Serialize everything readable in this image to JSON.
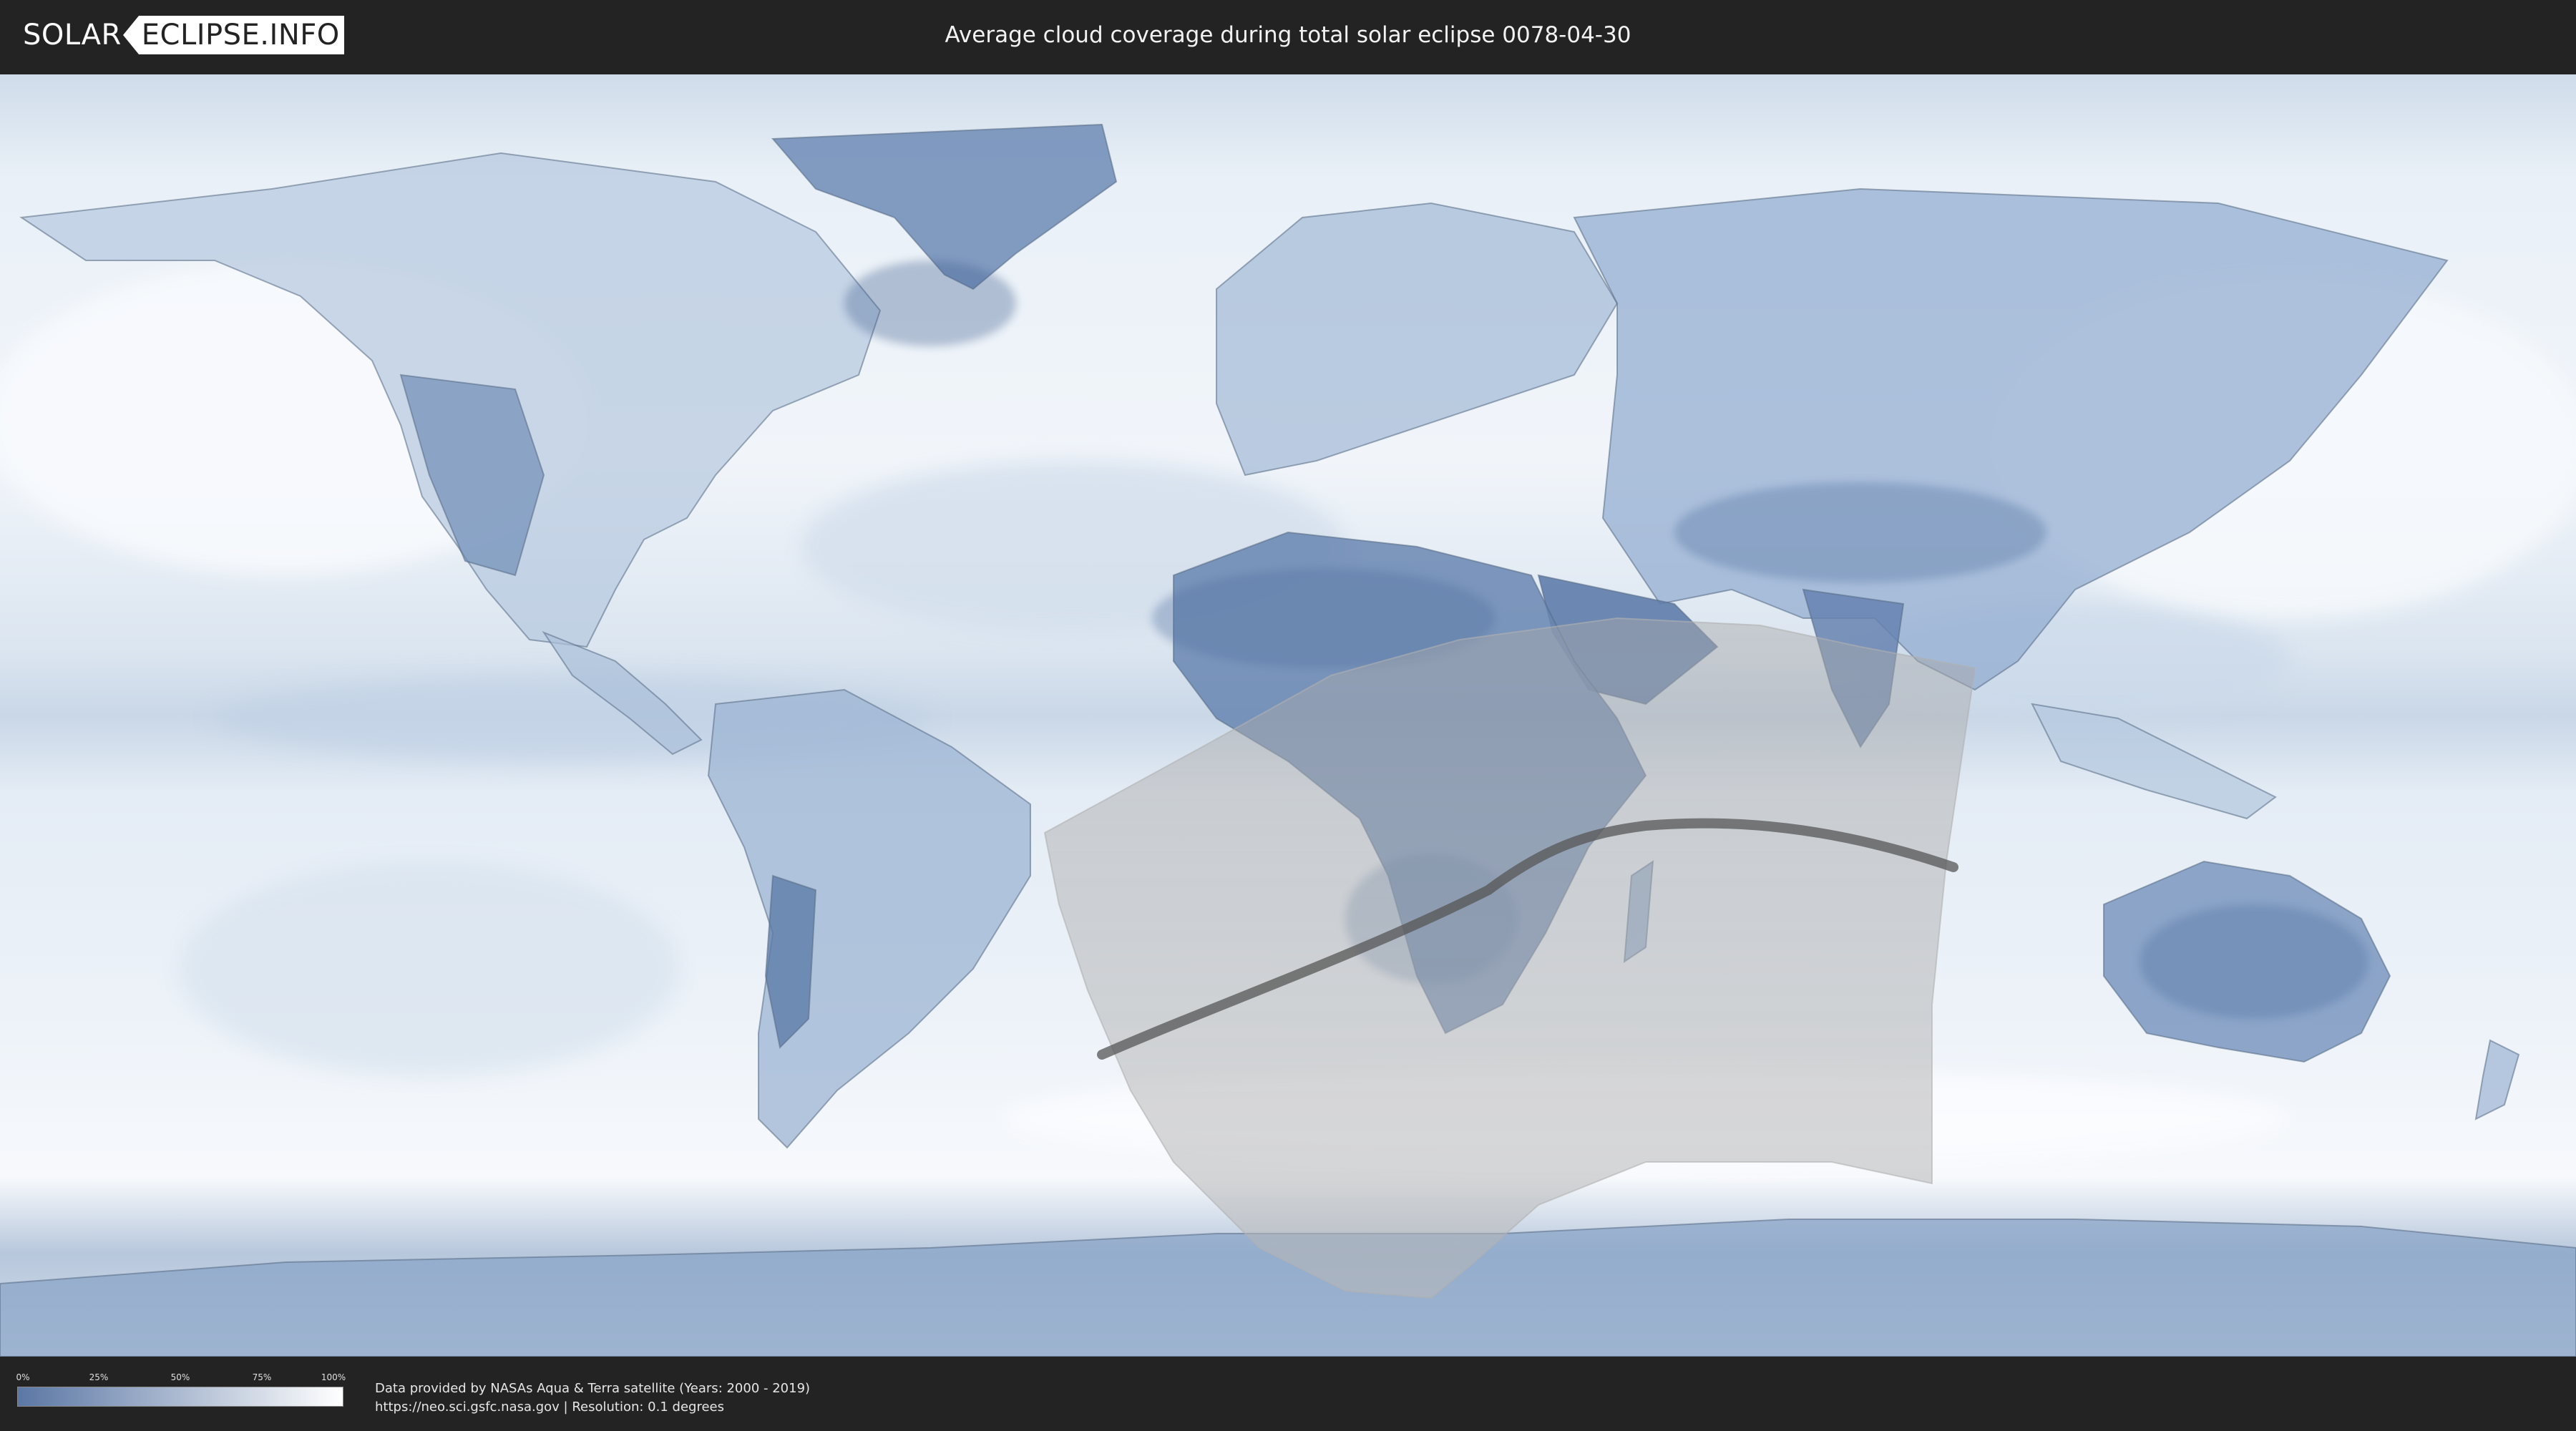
{
  "header": {
    "logo": {
      "left_text": "SOLAR",
      "right_text": "ECLIPSE.INFO"
    },
    "title": "Average cloud coverage during total solar eclipse 0078-04-30"
  },
  "map": {
    "projection": "equirectangular",
    "overlay_colors": {
      "ocean_cloudy": "#f3f7fb",
      "clear_sky": "#5b7aa8",
      "land_outline": "#4f5f75",
      "eclipse_path": "#555555",
      "eclipse_zone": "#9b9b9b"
    },
    "eclipse_central_line_icon": "eclipse-path-line",
    "visibility_zone_icon": "eclipse-visibility-zone"
  },
  "legend": {
    "ticks": [
      "0%",
      "25%",
      "50%",
      "75%",
      "100%"
    ],
    "gradient_start": "#5b77a4",
    "gradient_end": "#ffffff"
  },
  "credits": {
    "line1": "Data provided by NASAs Aqua & Terra satellite (Years: 2000 - 2019)",
    "line2": "https://neo.sci.gsfc.nasa.gov | Resolution: 0.1 degrees"
  }
}
